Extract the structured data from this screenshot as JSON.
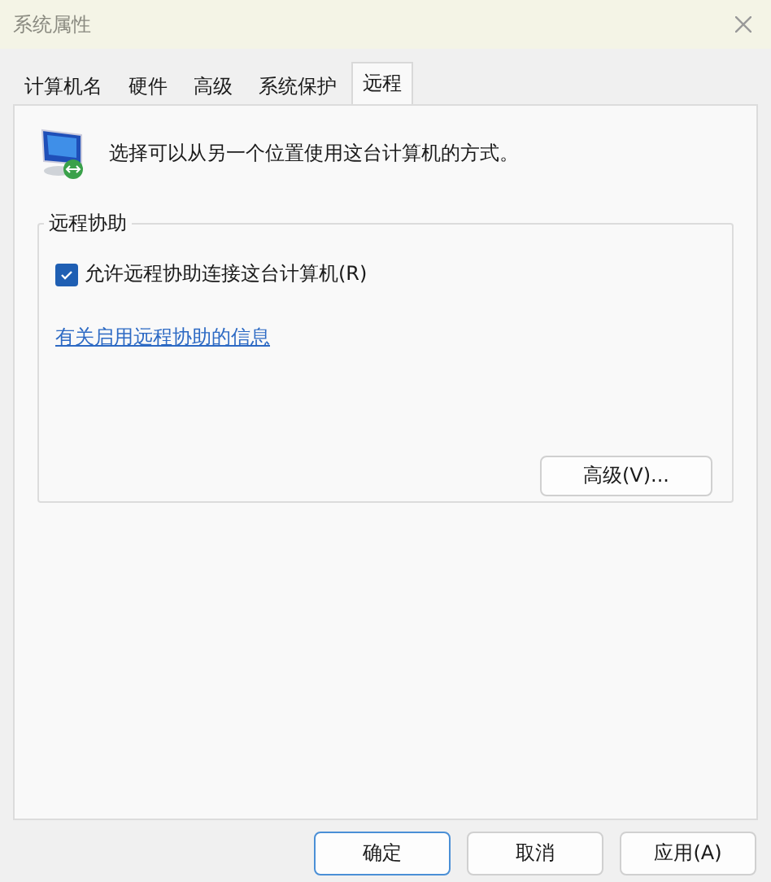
{
  "window": {
    "title": "系统属性"
  },
  "tabs": [
    {
      "label": "计算机名",
      "selected": false
    },
    {
      "label": "硬件",
      "selected": false
    },
    {
      "label": "高级",
      "selected": false
    },
    {
      "label": "系统保护",
      "selected": false
    },
    {
      "label": "远程",
      "selected": true
    }
  ],
  "intro": "选择可以从另一个位置使用这台计算机的方式。",
  "group": {
    "title": "远程协助",
    "checkbox": {
      "label": "允许远程协助连接这台计算机(R)",
      "checked": true
    },
    "link": "有关启用远程协助的信息",
    "button": "高级(V)..."
  },
  "buttons": [
    {
      "label": "确定",
      "default": true
    },
    {
      "label": "取消",
      "default": false
    },
    {
      "label": "应用(A)",
      "default": false
    }
  ]
}
